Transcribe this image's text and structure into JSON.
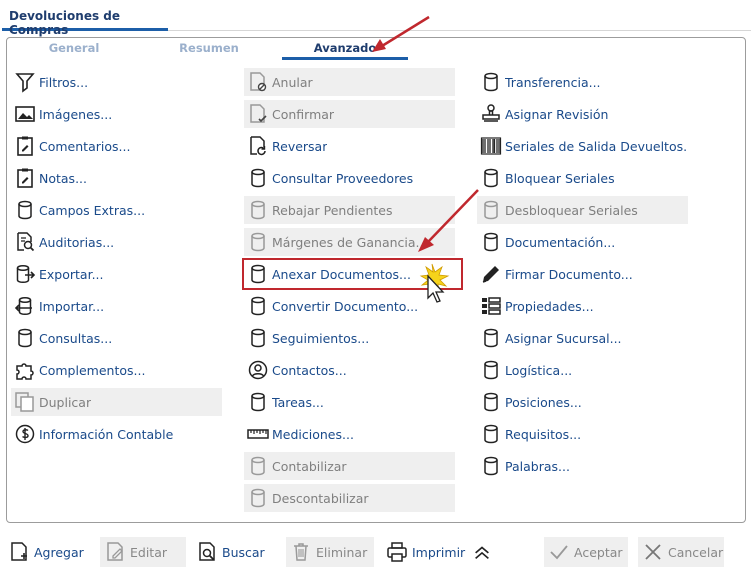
{
  "window": {
    "title": "Devoluciones de Compras"
  },
  "tabs": [
    {
      "label": "General",
      "active": false
    },
    {
      "label": "Resumen",
      "active": false
    },
    {
      "label": "Avanzado",
      "active": true
    }
  ],
  "columns": [
    [
      {
        "label": "Filtros...",
        "icon": "filter-icon",
        "disabled": false
      },
      {
        "label": "Imágenes...",
        "icon": "image-icon",
        "disabled": false
      },
      {
        "label": "Comentarios...",
        "icon": "clipboard-edit-icon",
        "disabled": false
      },
      {
        "label": "Notas...",
        "icon": "clipboard-edit-icon",
        "disabled": false
      },
      {
        "label": "Campos Extras...",
        "icon": "database-icon",
        "disabled": false
      },
      {
        "label": "Auditorias...",
        "icon": "audit-search-icon",
        "disabled": false
      },
      {
        "label": "Exportar...",
        "icon": "export-icon",
        "disabled": false
      },
      {
        "label": "Importar...",
        "icon": "import-icon",
        "disabled": false
      },
      {
        "label": "Consultas...",
        "icon": "database-icon",
        "disabled": false
      },
      {
        "label": "Complementos...",
        "icon": "puzzle-icon",
        "disabled": false
      },
      {
        "label": "Duplicar",
        "icon": "duplicate-icon",
        "disabled": true
      },
      {
        "label": "Información Contable",
        "icon": "dollar-circle-icon",
        "disabled": false
      }
    ],
    [
      {
        "label": "Anular",
        "icon": "document-cancel-icon",
        "disabled": true
      },
      {
        "label": "Confirmar",
        "icon": "document-check-icon",
        "disabled": true
      },
      {
        "label": "Reversar",
        "icon": "document-revert-icon",
        "disabled": false
      },
      {
        "label": "Consultar Proveedores",
        "icon": "database-icon",
        "disabled": false
      },
      {
        "label": "Rebajar Pendientes",
        "icon": "database-icon",
        "disabled": true
      },
      {
        "label": "Márgenes de Ganancia...",
        "icon": "database-icon",
        "disabled": true
      },
      {
        "label": "Anexar Documentos...",
        "icon": "database-icon",
        "disabled": false,
        "highlight": true
      },
      {
        "label": "Convertir Documento...",
        "icon": "database-icon",
        "disabled": false
      },
      {
        "label": "Seguimientos...",
        "icon": "database-icon",
        "disabled": false
      },
      {
        "label": "Contactos...",
        "icon": "contact-icon",
        "disabled": false
      },
      {
        "label": "Tareas...",
        "icon": "database-icon",
        "disabled": false
      },
      {
        "label": "Mediciones...",
        "icon": "ruler-icon",
        "disabled": false
      },
      {
        "label": "Contabilizar",
        "icon": "database-icon",
        "disabled": true
      },
      {
        "label": "Descontabilizar",
        "icon": "database-icon",
        "disabled": true
      }
    ],
    [
      {
        "label": "Transferencia...",
        "icon": "database-icon",
        "disabled": false
      },
      {
        "label": "Asignar Revisión",
        "icon": "stamp-icon",
        "disabled": false
      },
      {
        "label": "Seriales de Salida Devueltos...",
        "icon": "barcode-icon",
        "disabled": false
      },
      {
        "label": "Bloquear Seriales",
        "icon": "database-icon",
        "disabled": false
      },
      {
        "label": "Desbloquear Seriales",
        "icon": "database-icon",
        "disabled": true
      },
      {
        "label": "Documentación...",
        "icon": "database-icon",
        "disabled": false
      },
      {
        "label": "Firmar Documento...",
        "icon": "pen-icon",
        "disabled": false
      },
      {
        "label": "Propiedades...",
        "icon": "properties-grid-icon",
        "disabled": false
      },
      {
        "label": "Asignar Sucursal...",
        "icon": "database-icon",
        "disabled": false
      },
      {
        "label": "Logística...",
        "icon": "database-icon",
        "disabled": false
      },
      {
        "label": "Posiciones...",
        "icon": "database-icon",
        "disabled": false
      },
      {
        "label": "Requisitos...",
        "icon": "database-icon",
        "disabled": false
      },
      {
        "label": "Palabras...",
        "icon": "database-icon",
        "disabled": false
      }
    ]
  ],
  "footer": {
    "add": "Agregar",
    "edit": "Editar",
    "search": "Buscar",
    "delete": "Eliminar",
    "print": "Imprimir",
    "accept": "Aceptar",
    "cancel": "Cancelar"
  }
}
